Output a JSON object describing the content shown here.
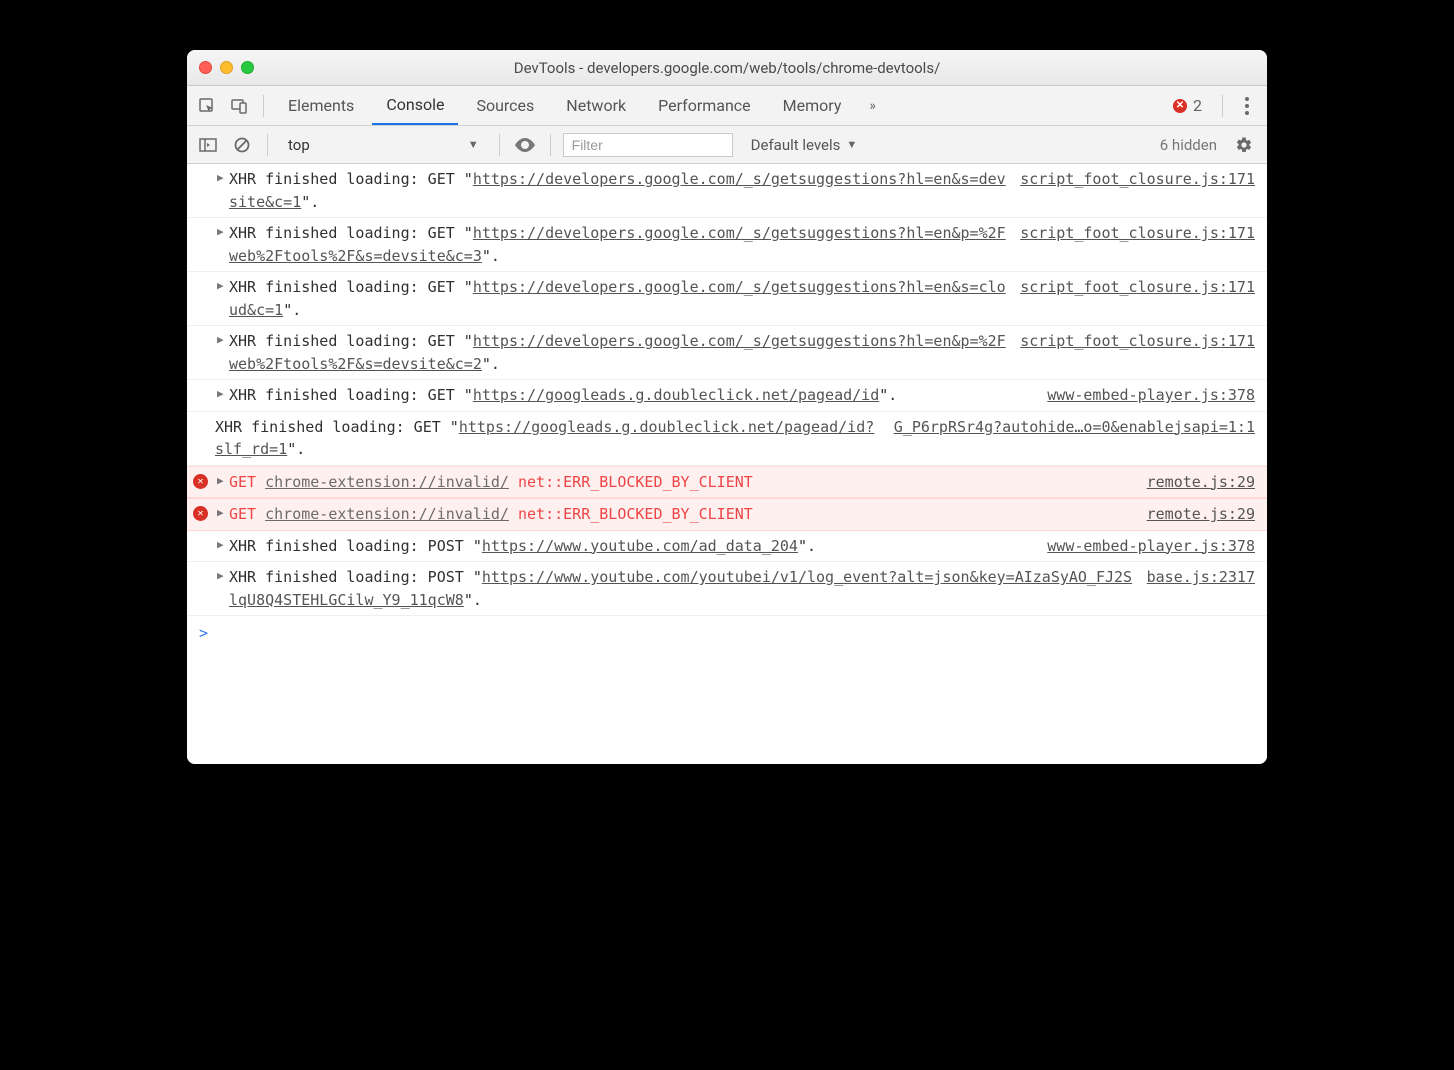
{
  "window": {
    "title": "DevTools - developers.google.com/web/tools/chrome-devtools/"
  },
  "tabs": {
    "elements": "Elements",
    "console": "Console",
    "sources": "Sources",
    "network": "Network",
    "performance": "Performance",
    "memory": "Memory"
  },
  "error_count": "2",
  "toolbar": {
    "context": "top",
    "filter_placeholder": "Filter",
    "levels": "Default levels",
    "hidden": "6 hidden"
  },
  "logs": [
    {
      "type": "xhr",
      "prefix": "XHR finished loading: GET \"",
      "url": "https://developers.google.com/_s/getsuggestions?hl=en&s=devsite&c=1",
      "suffix": "\".",
      "source": "script_foot_closure.js:171",
      "disclosure": true
    },
    {
      "type": "xhr",
      "prefix": "XHR finished loading: GET \"",
      "url": "https://developers.google.com/_s/getsuggestions?hl=en&p=%2Fweb%2Ftools%2F&s=devsite&c=3",
      "suffix": "\".",
      "source": "script_foot_closure.js:171",
      "disclosure": true
    },
    {
      "type": "xhr",
      "prefix": "XHR finished loading: GET \"",
      "url": "https://developers.google.com/_s/getsuggestions?hl=en&s=cloud&c=1",
      "suffix": "\".",
      "source": "script_foot_closure.js:171",
      "disclosure": true
    },
    {
      "type": "xhr",
      "prefix": "XHR finished loading: GET \"",
      "url": "https://developers.google.com/_s/getsuggestions?hl=en&p=%2Fweb%2Ftools%2F&s=devsite&c=2",
      "suffix": "\".",
      "source": "script_foot_closure.js:171",
      "disclosure": true
    },
    {
      "type": "xhr",
      "prefix": "XHR finished loading: GET \"",
      "url": "https://googleads.g.doubleclick.net/pagead/id",
      "suffix": "\".",
      "source": "www-embed-player.js:378",
      "disclosure": true
    },
    {
      "type": "xhr",
      "prefix": "XHR finished loading: GET \"",
      "url": "https://googleads.g.doubleclick.net/pagead/id?slf_rd=1",
      "suffix": "\".",
      "source": "G_P6rpRSr4g?autohide…o=0&enablejsapi=1:1",
      "disclosure": false
    },
    {
      "type": "error",
      "method": "GET",
      "url": "chrome-extension://invalid/",
      "err": "net::ERR_BLOCKED_BY_CLIENT",
      "source": "remote.js:29"
    },
    {
      "type": "error",
      "method": "GET",
      "url": "chrome-extension://invalid/",
      "err": "net::ERR_BLOCKED_BY_CLIENT",
      "source": "remote.js:29"
    },
    {
      "type": "xhr",
      "prefix": "XHR finished loading: POST \"",
      "url": "https://www.youtube.com/ad_data_204",
      "suffix": "\".",
      "source": "www-embed-player.js:378",
      "disclosure": true
    },
    {
      "type": "xhr",
      "prefix": "XHR finished loading: POST \"",
      "url": "https://www.youtube.com/youtubei/v1/log_event?alt=json&key=AIzaSyAO_FJ2SlqU8Q4STEHLGCilw_Y9_11qcW8",
      "suffix": "\".",
      "source": "base.js:2317",
      "disclosure": true
    }
  ],
  "prompt": ">"
}
